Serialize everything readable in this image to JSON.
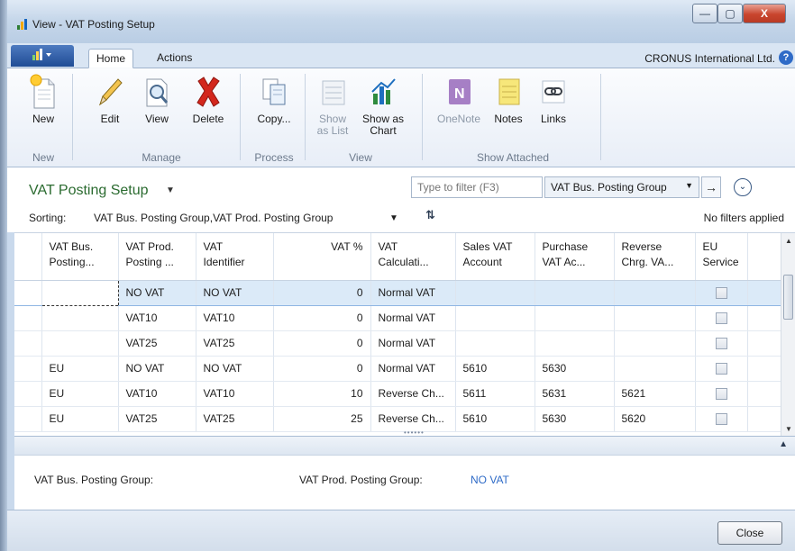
{
  "window": {
    "title": "View - VAT Posting Setup",
    "min_glyph": "—",
    "max_glyph": "▢",
    "close_glyph": "X"
  },
  "tabs": {
    "home": "Home",
    "actions": "Actions"
  },
  "company": "CRONUS International Ltd.",
  "help_glyph": "?",
  "ribbon": {
    "new": "New",
    "edit": "Edit",
    "view": "View",
    "delete": "Delete",
    "copy": "Copy...",
    "show_as_list_1": "Show",
    "show_as_list_2": "as List",
    "show_as_chart_1": "Show as",
    "show_as_chart_2": "Chart",
    "onenote": "OneNote",
    "notes": "Notes",
    "links": "Links",
    "groups": {
      "new": "New",
      "manage": "Manage",
      "process": "Process",
      "view": "View",
      "show_attached": "Show Attached"
    }
  },
  "page": {
    "title": "VAT Posting Setup",
    "filter_placeholder": "Type to filter (F3)",
    "filter_field": "VAT Bus. Posting Group",
    "sorting_label": "Sorting:",
    "sorting_value": "VAT Bus. Posting Group,VAT Prod. Posting Group",
    "no_filters": "No filters applied"
  },
  "columns": {
    "c1a": "VAT Bus.",
    "c1b": "Posting...",
    "c2a": "VAT Prod.",
    "c2b": "Posting ...",
    "c3a": "VAT",
    "c3b": "Identifier",
    "c4a": "VAT %",
    "c5a": "VAT",
    "c5b": "Calculati...",
    "c6a": "Sales VAT",
    "c6b": "Account",
    "c7a": "Purchase",
    "c7b": "VAT Ac...",
    "c8a": "Reverse",
    "c8b": "Chrg. VA...",
    "c9a": "EU",
    "c9b": "Service"
  },
  "rows": [
    {
      "bus": "",
      "prod": "NO VAT",
      "ident": "NO VAT",
      "pct": "0",
      "calc": "Normal VAT",
      "sales": "",
      "purch": "",
      "rev": ""
    },
    {
      "bus": "",
      "prod": "VAT10",
      "ident": "VAT10",
      "pct": "0",
      "calc": "Normal VAT",
      "sales": "",
      "purch": "",
      "rev": ""
    },
    {
      "bus": "",
      "prod": "VAT25",
      "ident": "VAT25",
      "pct": "0",
      "calc": "Normal VAT",
      "sales": "",
      "purch": "",
      "rev": ""
    },
    {
      "bus": "EU",
      "prod": "NO VAT",
      "ident": "NO VAT",
      "pct": "0",
      "calc": "Normal VAT",
      "sales": "5610",
      "purch": "5630",
      "rev": ""
    },
    {
      "bus": "EU",
      "prod": "VAT10",
      "ident": "VAT10",
      "pct": "10",
      "calc": "Reverse Ch...",
      "sales": "5611",
      "purch": "5631",
      "rev": "5621"
    },
    {
      "bus": "EU",
      "prod": "VAT25",
      "ident": "VAT25",
      "pct": "25",
      "calc": "Reverse Ch...",
      "sales": "5610",
      "purch": "5630",
      "rev": "5620"
    }
  ],
  "details": {
    "bus_label": "VAT Bus. Posting Group:",
    "prod_label": "VAT Prod. Posting Group:",
    "prod_value": "NO VAT"
  },
  "footer": {
    "close": "Close"
  },
  "colors": {
    "title_green": "#2b6b30",
    "link_blue": "#2f6bc7",
    "selection": "#dbeaf8"
  }
}
